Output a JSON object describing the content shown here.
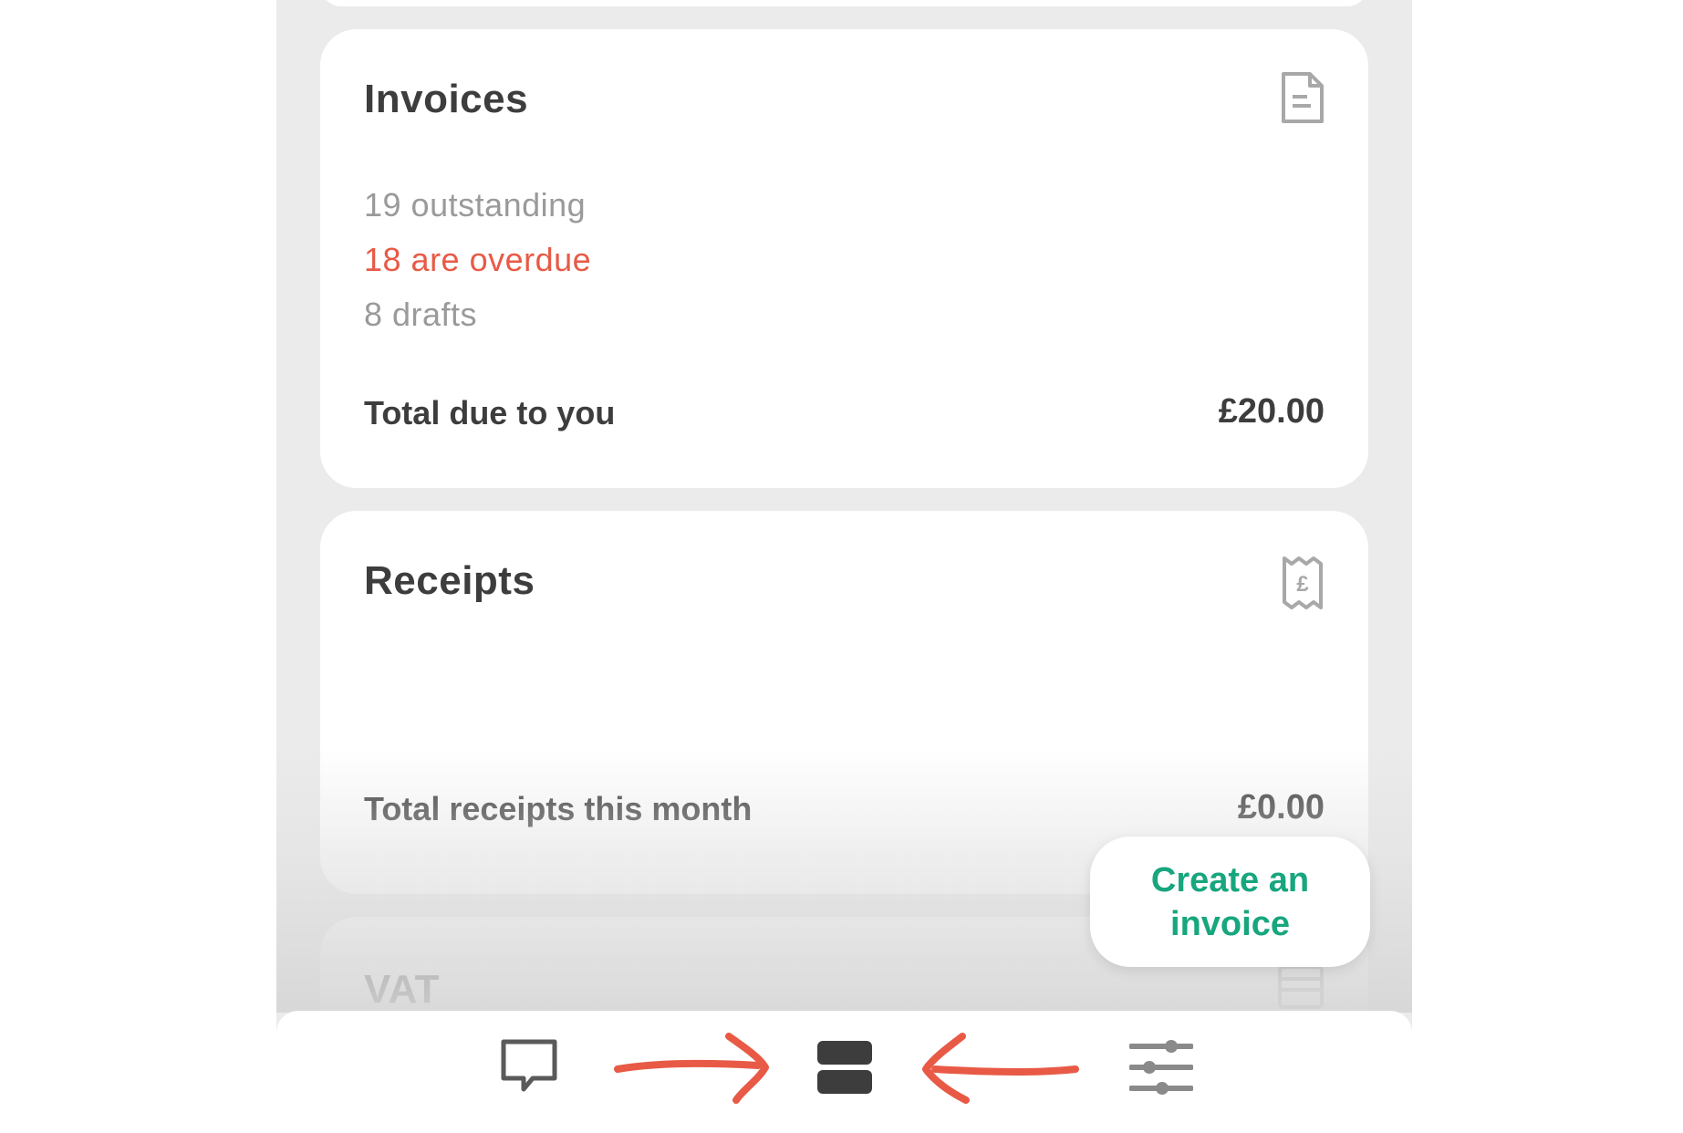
{
  "invoices": {
    "title": "Invoices",
    "icon": "document-icon",
    "outstanding": "19 outstanding",
    "overdue": "18 are overdue",
    "drafts": "8 drafts",
    "total_label": "Total due to you",
    "total_value": "£20.00"
  },
  "receipts": {
    "title": "Receipts",
    "icon": "receipt-pound-icon",
    "total_label": "Total receipts this month",
    "total_value": "£0.00"
  },
  "vat": {
    "title": "VAT",
    "icon": "calculator-icon"
  },
  "fab": {
    "label": "Create an invoice"
  },
  "tabbar": {
    "items": [
      {
        "icon": "chat-bubble-icon",
        "active": false
      },
      {
        "icon": "stacked-cards-icon",
        "active": true
      },
      {
        "icon": "sliders-icon",
        "active": false
      }
    ]
  },
  "annotations": {
    "arrow_color": "#e85a46"
  },
  "colors": {
    "background": "#ebebeb",
    "card": "#ffffff",
    "text_dark": "#3d3d3d",
    "text_muted": "#9a9a9a",
    "overdue": "#e85a46",
    "accent_green": "#17a67e"
  }
}
